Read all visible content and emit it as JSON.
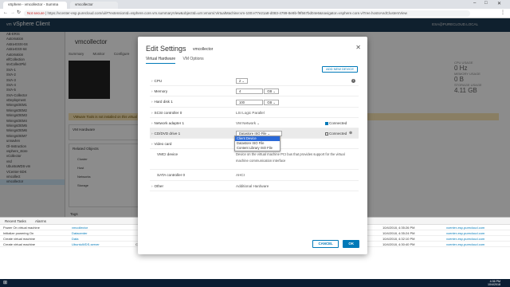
{
  "browser": {
    "tabs": [
      {
        "label": "vSphere - vmcollector - Summa"
      },
      {
        "label": "vmcollector"
      }
    ],
    "address_prefix": "Not secure",
    "address_text": "https://vcenter-esp.purecloud.com/ui/#?extensionId=vsphere.core.vm.summaryView&objectId=urn:vmomi:VirtualMachine:vm-100:e77e21a8-d083-4799-8e9b-f9f567bd04e6&navigator=vsphere.core.viTree.hostsAndClustersView"
  },
  "vsphere": {
    "app_name": "vSphere Client",
    "user": "ESA@PURECLOUD.LOCAL"
  },
  "sidebar": {
    "items": [
      "AB-ERIS",
      "Automation",
      "Astra-ESXI-04",
      "Astra-ESX-64",
      "Automation",
      "elfCollection",
      "srvCollectPld",
      "SVA-1",
      "SVA-2",
      "SVA-3",
      "SVA-4",
      "SVA-5",
      "SVA-Collector",
      "vDeployment",
      "WinngsOEM1",
      "WinngsOEM2",
      "WinngsOEM3",
      "WinngsOEM4",
      "WinngsOEM5",
      "WinngsOEM6",
      "WinngsOEM7",
      "unnavlen",
      "Ol-Instruction",
      "vsphere_store",
      "vCollector",
      "vnd",
      "UbuntuWDS-vm",
      "VCenter-SDK",
      "vmcollect",
      "vmcollector"
    ]
  },
  "main": {
    "vm_title": "vmcollector",
    "tabs": [
      "Summary",
      "Monitor",
      "Configure"
    ],
    "stats": [
      {
        "label": "CPU USAGE",
        "value": "0 Hz"
      },
      {
        "label": "MEMORY USAGE",
        "value": "0 B"
      },
      {
        "label": "STORAGE USAGE",
        "value": "4.11 GB"
      }
    ],
    "warning": "VMware Tools is not installed on this virtual machine.",
    "vm_hardware": "VM Hardware",
    "related_objects": "Related Objects",
    "related_rows": [
      "Cluster",
      "Host",
      "Networks",
      "Storage"
    ],
    "tags": "Tags"
  },
  "modal": {
    "title": "Edit Settings",
    "vm_name": "vmcollector",
    "tabs": [
      "Virtual Hardware",
      "VM Options"
    ],
    "add_device": "ADD NEW DEVICE",
    "hardware": {
      "cpu_label": "CPU",
      "cpu_value": "2",
      "memory_label": "Memory",
      "memory_value": "4",
      "memory_unit": "GB",
      "disk_label": "Hard disk 1",
      "disk_value": "100",
      "disk_unit": "GB",
      "scsi_label": "SCSI controller 0",
      "scsi_value": "LSI Logic Parallel",
      "net_label": "Network adapter 1",
      "net_value": "VM Network",
      "net_connected": "Connected",
      "cd_label": "CD/DVD drive 1",
      "cd_value": "Datastore ISO File",
      "cd_connected": "Connected",
      "video_label": "Video card",
      "vmci_label": "VMCI device",
      "vmci_desc": "Device on the virtual machine PCI bus that provides support for the virtual machine communication interface",
      "sata_label": "SATA controller 0",
      "sata_value": "AHCI",
      "other_label": "Other",
      "other_value": "Additional Hardware"
    },
    "cd_options": [
      "Client Device",
      "Datastore ISO File",
      "Content Library ISO File"
    ],
    "cancel": "CANCEL",
    "ok": "OK"
  },
  "tasks": {
    "tabs": [
      "Recent Tasks",
      "Alarms"
    ],
    "rows": [
      {
        "name": "Power On virtual machine",
        "target": "vmcollector",
        "status": "",
        "time": "10/4/2018, 4:35:26 PM",
        "server": "vcenter-esp.purecloud.com"
      },
      {
        "name": "Initialize powering On",
        "target": "Datacenter",
        "status": "",
        "time": "10/4/2018, 4:35:24 PM",
        "server": "vcenter-esp.purecloud.com"
      },
      {
        "name": "Create virtual machine",
        "target": "Data",
        "status": "",
        "time": "10/4/2018, 4:32:10 PM",
        "server": "vcenter-esp.purecloud.com"
      },
      {
        "name": "Create virtual machine",
        "target": "UbuntuWDS-server",
        "status": "Completed",
        "time": "10/4/2018, 4:30:40 PM",
        "server": "vcenter-esp.purecloud.com"
      }
    ]
  },
  "taskbar": {
    "time": "4:36 PM",
    "date": "10/4/2018"
  }
}
